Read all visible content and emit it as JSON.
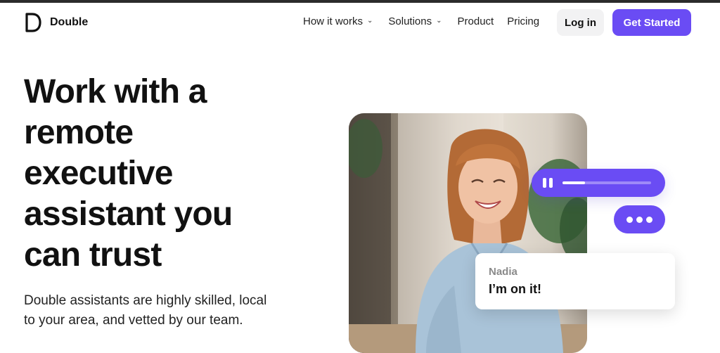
{
  "brand": {
    "name": "Double",
    "logo_icon": "double-d-logo-icon"
  },
  "nav": {
    "items": [
      {
        "label": "How it works",
        "has_dropdown": true
      },
      {
        "label": "Solutions",
        "has_dropdown": true
      },
      {
        "label": "Product",
        "has_dropdown": false
      },
      {
        "label": "Pricing",
        "has_dropdown": false
      }
    ],
    "dropdown_icon": "chevron-down-icon"
  },
  "header_actions": {
    "login_label": "Log in",
    "cta_label": "Get Started"
  },
  "hero": {
    "title_lines": [
      "Work with a",
      "remote",
      "executive",
      "assistant you",
      "can trust"
    ],
    "subtitle_lines": [
      "Double assistants are highly skilled, local",
      "to your area, and vetted by our team."
    ]
  },
  "audio_player": {
    "icon": "pause-icon",
    "progress": 0.25
  },
  "typing_indicator": {
    "icon": "typing-dots-icon"
  },
  "message": {
    "name": "Nadia",
    "text": "I’m on it!"
  },
  "colors": {
    "accent": "#6a4cf4",
    "text": "#111111",
    "muted": "#8a8a8a",
    "secondary_button": "#f2f2f3"
  }
}
